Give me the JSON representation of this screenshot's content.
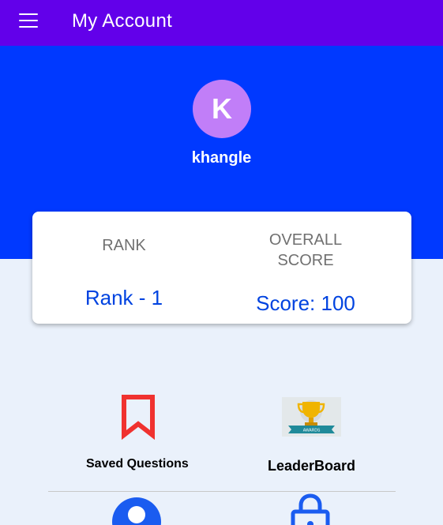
{
  "appbar": {
    "title": "My Account",
    "menu_icon": "hamburger-menu-icon"
  },
  "profile": {
    "avatar_initial": "K",
    "username": "khangle",
    "avatar_color": "#c17ef8"
  },
  "stats": {
    "rank_label": "RANK",
    "rank_value": "Rank - 1",
    "score_label_line1": "OVERALL",
    "score_label_line2": "SCORE",
    "score_value": "Score: 100"
  },
  "features": {
    "saved_questions": {
      "label": "Saved Questions",
      "icon": "bookmark-icon"
    },
    "leaderboard": {
      "label": "LeaderBoard",
      "icon": "trophy-awards-icon"
    },
    "profile": {
      "icon": "user-icon"
    },
    "password": {
      "icon": "lock-icon"
    }
  },
  "colors": {
    "appbar": "#6200ea",
    "hero": "#0039ff",
    "accent_text": "#0043e0",
    "bookmark": "#f0322f"
  }
}
